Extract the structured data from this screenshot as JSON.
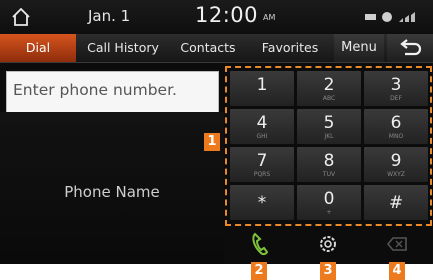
{
  "status": {
    "date": "Jan. 1",
    "time": "12:00",
    "ampm": "AM"
  },
  "tabs": [
    {
      "label": "Dial",
      "active": true
    },
    {
      "label": "Call History",
      "active": false
    },
    {
      "label": "Contacts",
      "active": false
    },
    {
      "label": "Favorites",
      "active": false
    }
  ],
  "menu_label": "Menu",
  "input": {
    "placeholder": "Enter phone number."
  },
  "phone_name": "Phone Name",
  "keys": [
    {
      "digit": "1",
      "letters": ""
    },
    {
      "digit": "2",
      "letters": "ABC"
    },
    {
      "digit": "3",
      "letters": "DEF"
    },
    {
      "digit": "4",
      "letters": "GHI"
    },
    {
      "digit": "5",
      "letters": "JKL"
    },
    {
      "digit": "6",
      "letters": "MNO"
    },
    {
      "digit": "7",
      "letters": "PQRS"
    },
    {
      "digit": "8",
      "letters": "TUV"
    },
    {
      "digit": "9",
      "letters": "WXYZ"
    },
    {
      "digit": "*",
      "letters": ""
    },
    {
      "digit": "0",
      "letters": "+"
    },
    {
      "digit": "#",
      "letters": ""
    }
  ],
  "callouts": [
    "1",
    "2",
    "3",
    "4"
  ],
  "colors": {
    "accent": "#d6541e",
    "call_green": "#7cc33a",
    "callout": "#ee7a1e"
  }
}
